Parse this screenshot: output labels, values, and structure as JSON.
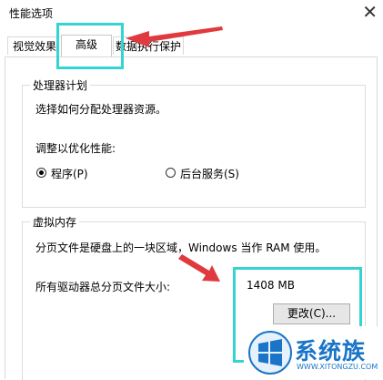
{
  "window": {
    "title": "性能选项",
    "close_glyph": "✕"
  },
  "tabs": [
    {
      "label": "视觉效果"
    },
    {
      "label": "高级"
    },
    {
      "label": "数据执行保护"
    }
  ],
  "processor": {
    "legend": "处理器计划",
    "description": "选择如何分配处理器资源。",
    "optimize_label": "调整以优化性能:",
    "option_programs": "程序(P)",
    "option_services": "后台服务(S)",
    "selected": "程序(P)"
  },
  "virtual_memory": {
    "legend": "虚拟内存",
    "description": "分页文件是硬盘上的一块区域，Windows 当作 RAM 使用。",
    "total_label": "所有驱动器总分页文件大小:",
    "total_value": "1408 MB",
    "change_button": "更改(C)..."
  },
  "watermark": {
    "brand": "系统族",
    "url": "WWW.XITONGZU.COM"
  },
  "colors": {
    "highlight": "#35d4d4",
    "arrow": "#e0393e",
    "brand": "#1a75c9"
  }
}
